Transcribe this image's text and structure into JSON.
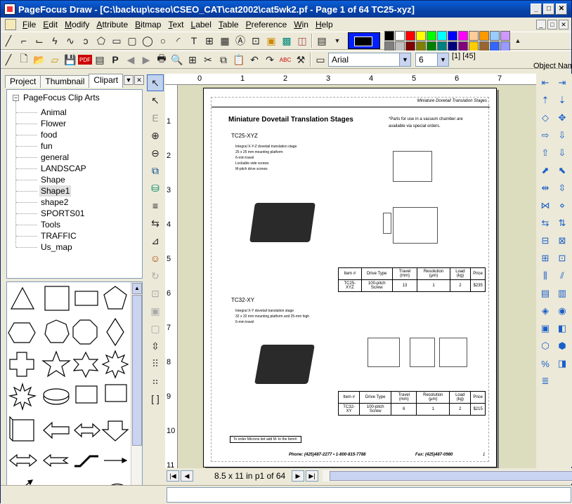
{
  "window": {
    "title": "PageFocus Draw - [C:\\backup\\cseo\\CSEO_CAT\\cat2002\\cat5wk2.pf - Page 1 of 64 TC25-xyz]",
    "min": "_",
    "max": "□",
    "close": "✕"
  },
  "menu": [
    "File",
    "Edit",
    "Modify",
    "Attribute",
    "Bitmap",
    "Text",
    "Label",
    "Table",
    "Preference",
    "Win",
    "Help"
  ],
  "palette": [
    "#000000",
    "#ffffff",
    "#ff0000",
    "#ffff00",
    "#00ff00",
    "#00ffff",
    "#0000ff",
    "#ff00ff",
    "#ffcc99",
    "#ff9900",
    "#99ccff",
    "#cc99ff",
    "#808080",
    "#c0c0c0",
    "#800000",
    "#808000",
    "#008000",
    "#008080",
    "#000080",
    "#800080",
    "#ffcc00",
    "#996633",
    "#3366ff",
    "#9999ff"
  ],
  "font": {
    "name": "Arial",
    "size": "6",
    "indicator": "[1] [45]"
  },
  "object_name_label": "Object Nam",
  "tabs": [
    "Project",
    "Thumbnail",
    "Clipart"
  ],
  "tree": {
    "root": "PageFocus Clip Arts",
    "items": [
      "Animal",
      "Flower",
      "food",
      "fun",
      "general",
      "LANDSCAP",
      "Shape",
      "Shape1",
      "shape2",
      "SPORTS01",
      "Tools",
      "TRAFFIC",
      "Us_map"
    ],
    "selected": "Shape1"
  },
  "ruler": {
    "h": [
      "0",
      "1",
      "2",
      "3",
      "4",
      "5",
      "6",
      "7"
    ],
    "v": [
      "1",
      "2",
      "3",
      "4",
      "5",
      "6",
      "7",
      "8",
      "9",
      "10",
      "11"
    ]
  },
  "doc": {
    "header_right": "Miniature Dovetail Translation Stages",
    "title": "Miniature Dovetail Translation Stages",
    "note1": "*Parts for use in a vacuum chamber are",
    "note2": "available via special orders.",
    "p1": {
      "name": "TC25-XYZ",
      "bullets": [
        "Integral X-Y-Z dovetail translation stage",
        "25 x 25 mm mounting platform",
        "6-mm travel",
        "Lockable side screws",
        "M-pitch drive screws"
      ],
      "table_head": [
        "Item #",
        "Drive Type",
        "Travel (mm)",
        "Resolution (μm)",
        "Load (kg)",
        "Price"
      ],
      "table_row": [
        "TC25-XYZ",
        "100-pitch Screw",
        "13",
        "1",
        "2",
        "$235"
      ]
    },
    "p2": {
      "name": "TC32-XY",
      "bullets": [
        "Integral X-Y dovetail translation stage",
        "32 x 32 mm mounting platform and 25-mm high",
        "6-mm travel"
      ],
      "table_head": [
        "Item #",
        "Drive Type",
        "Travel (mm)",
        "Resolution (μm)",
        "Load (kg)",
        "Price"
      ],
      "table_row": [
        "TC32-XY",
        "100-pitch Screw",
        "6",
        "1",
        "2",
        "$215"
      ]
    },
    "order_box": "To order Microns dot add M- to the Item#.",
    "footer": "Phone: (425)487-2277  •  1-800-815-7788",
    "fax": "Fax: (425)487-0980",
    "page_no": "1"
  },
  "status": {
    "page_info": "8.5 x 11 in  p1 of 64"
  }
}
